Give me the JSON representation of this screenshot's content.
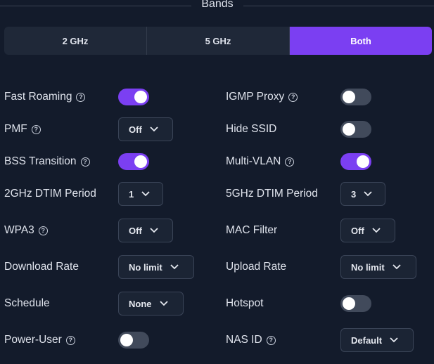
{
  "section": {
    "title": "Bands"
  },
  "bands": {
    "options": [
      "2 GHz",
      "5 GHz",
      "Both"
    ],
    "selected": "Both"
  },
  "settings": {
    "fast_roaming": {
      "label": "Fast Roaming",
      "enabled": true
    },
    "igmp_proxy": {
      "label": "IGMP Proxy",
      "enabled": false
    },
    "pmf": {
      "label": "PMF",
      "value": "Off"
    },
    "hide_ssid": {
      "label": "Hide SSID",
      "enabled": false
    },
    "bss_transition": {
      "label": "BSS Transition",
      "enabled": true
    },
    "multi_vlan": {
      "label": "Multi-VLAN",
      "enabled": true
    },
    "dtim_2ghz": {
      "label": "2GHz DTIM Period",
      "value": "1"
    },
    "dtim_5ghz": {
      "label": "5GHz DTIM Period",
      "value": "3"
    },
    "wpa3": {
      "label": "WPA3",
      "value": "Off"
    },
    "mac_filter": {
      "label": "MAC Filter",
      "value": "Off"
    },
    "download_rate": {
      "label": "Download Rate",
      "value": "No limit"
    },
    "upload_rate": {
      "label": "Upload Rate",
      "value": "No limit"
    },
    "schedule": {
      "label": "Schedule",
      "value": "None"
    },
    "hotspot": {
      "label": "Hotspot",
      "enabled": false
    },
    "power_user": {
      "label": "Power-User",
      "enabled": false
    },
    "nas_id": {
      "label": "NAS ID",
      "value": "Default"
    }
  },
  "icons": {
    "help": "help-circle-icon",
    "dropdown": "chevron-down-icon"
  },
  "colors": {
    "accent": "#7b3ff2",
    "background": "#131b2b",
    "toggle_off": "#414a5b"
  }
}
